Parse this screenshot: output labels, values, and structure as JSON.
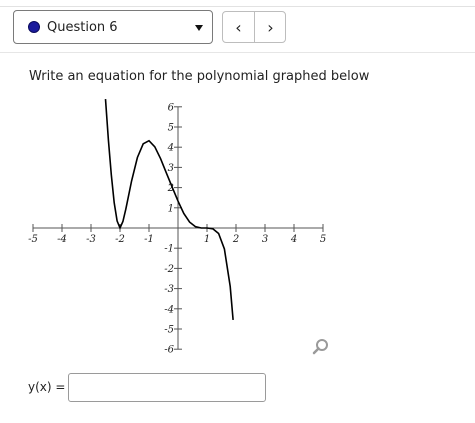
{
  "header": {
    "question_label": "Question 6",
    "prev_label": "‹",
    "next_label": "›"
  },
  "prompt": "Write an equation for the polynomial graphed below",
  "chart_data": {
    "type": "line",
    "xlim": [
      -5,
      5
    ],
    "ylim": [
      -6,
      6
    ],
    "grid": false,
    "x_tick_labels": [
      "-5",
      "-4",
      "-3",
      "-2",
      "-1",
      "1",
      "2",
      "3",
      "4",
      "5"
    ],
    "y_tick_labels": [
      "6",
      "5",
      "4",
      "3",
      "2",
      "1",
      "-1",
      "-2",
      "-3",
      "-4",
      "-5",
      "-6"
    ],
    "series": [
      {
        "x": [
          -2.5,
          -2.4,
          -2.3,
          -2.2,
          -2.1,
          -2.0,
          -1.9,
          -1.8,
          -1.6,
          -1.4,
          -1.2,
          -1.0,
          -0.8,
          -0.6,
          -0.4,
          -0.2,
          0.0,
          0.2,
          0.4,
          0.6,
          0.8,
          1.0,
          1.2,
          1.4,
          1.6,
          1.8,
          1.9
        ],
        "y": [
          6.38,
          4.35,
          2.64,
          1.25,
          0.35,
          0.0,
          0.32,
          0.93,
          2.33,
          3.49,
          4.17,
          4.32,
          4.02,
          3.43,
          2.72,
          2.02,
          1.33,
          0.72,
          0.29,
          0.07,
          0.0,
          0.0,
          -0.04,
          -0.27,
          -1.04,
          -2.89,
          -4.55
        ]
      }
    ]
  },
  "answer": {
    "label": "y(x) =",
    "value": "",
    "placeholder": ""
  },
  "icons": {
    "zoom": "magnifier-icon"
  }
}
